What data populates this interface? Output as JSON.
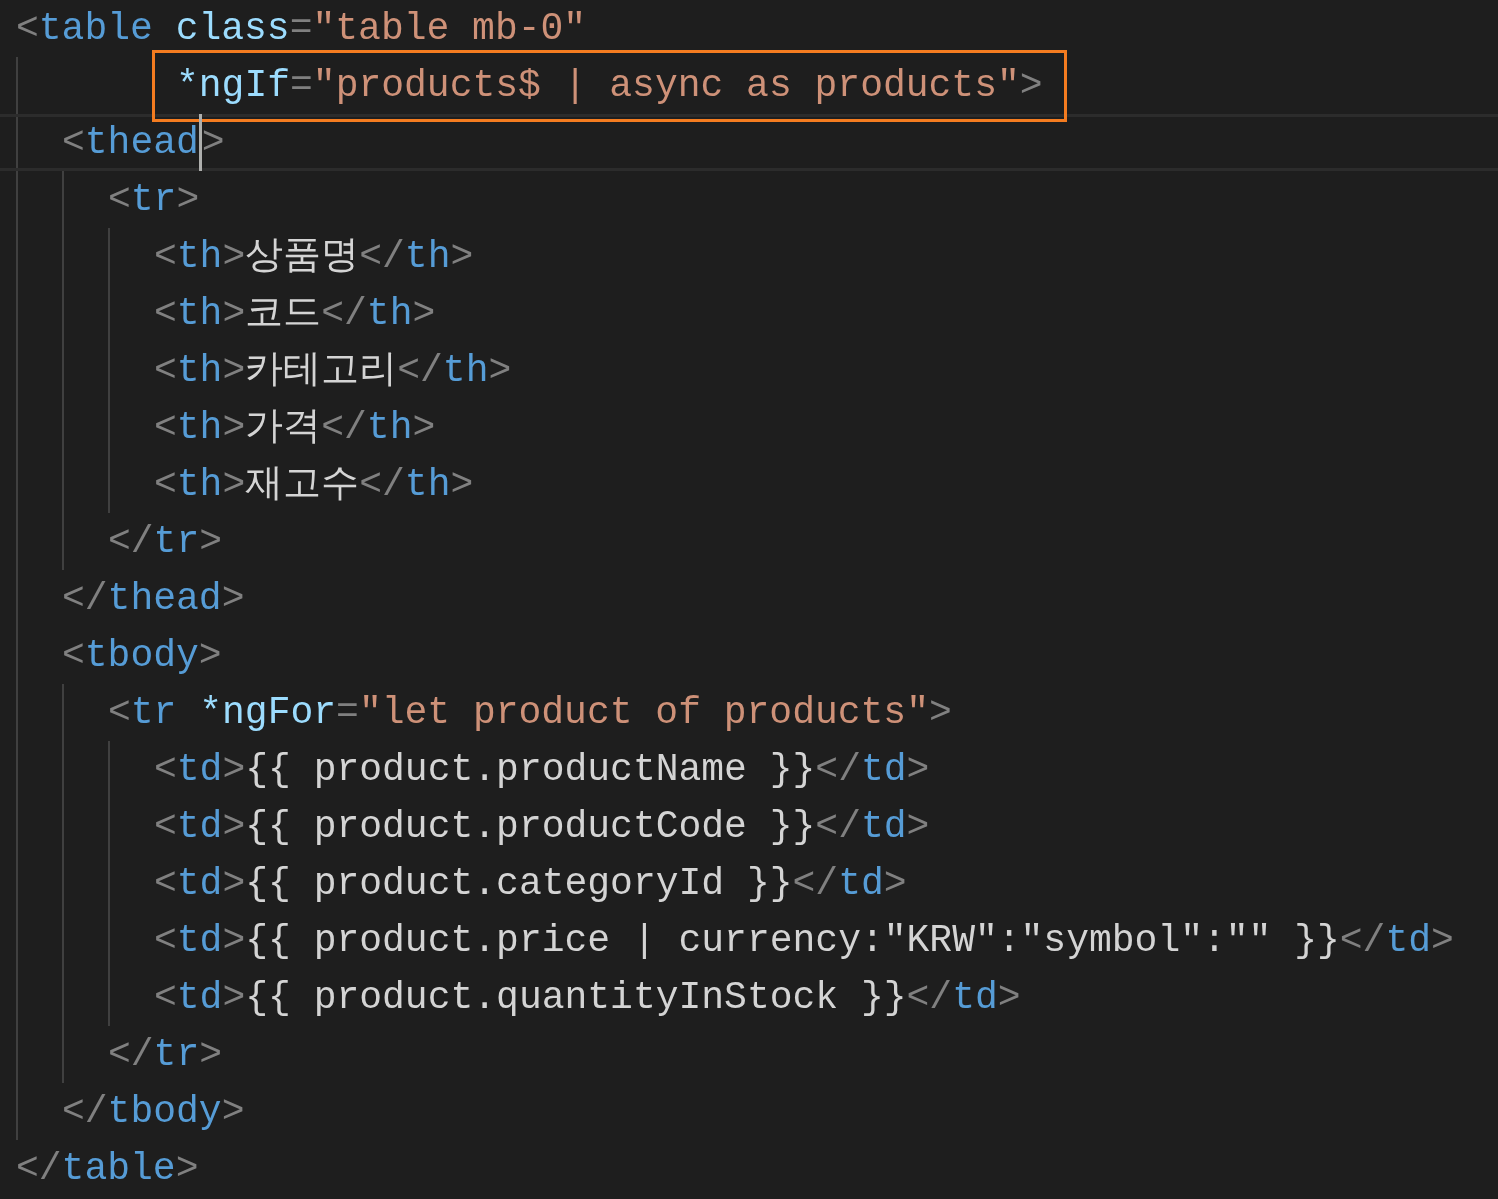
{
  "lines": [
    {
      "tokens": [
        {
          "kind": "punct",
          "text": "<"
        },
        {
          "kind": "tag",
          "text": "table"
        },
        {
          "kind": "attr",
          "text": " class"
        },
        {
          "kind": "punct",
          "text": "="
        },
        {
          "kind": "string",
          "text": "\"table mb-0\""
        }
      ],
      "continuation": {
        "highlighted": true,
        "tokens": [
          {
            "kind": "attr",
            "text": "*ngIf"
          },
          {
            "kind": "punct",
            "text": "="
          },
          {
            "kind": "string",
            "text": "\"products$ | async as products\""
          },
          {
            "kind": "punct",
            "text": ">"
          }
        ]
      },
      "children": [
        {
          "current": true,
          "tokens": [
            {
              "kind": "punct",
              "text": "<"
            },
            {
              "kind": "tag",
              "text": "thead",
              "cursor": true
            },
            {
              "kind": "punct",
              "text": ">"
            }
          ],
          "children": [
            {
              "tokens": [
                {
                  "kind": "punct",
                  "text": "<"
                },
                {
                  "kind": "tag",
                  "text": "tr"
                },
                {
                  "kind": "punct",
                  "text": ">"
                }
              ],
              "children": [
                {
                  "tokens": [
                    {
                      "kind": "punct",
                      "text": "<"
                    },
                    {
                      "kind": "tag",
                      "text": "th"
                    },
                    {
                      "kind": "punct",
                      "text": ">"
                    },
                    {
                      "kind": "text",
                      "text": "상품명"
                    },
                    {
                      "kind": "punct",
                      "text": "</"
                    },
                    {
                      "kind": "tag",
                      "text": "th"
                    },
                    {
                      "kind": "punct",
                      "text": ">"
                    }
                  ]
                },
                {
                  "tokens": [
                    {
                      "kind": "punct",
                      "text": "<"
                    },
                    {
                      "kind": "tag",
                      "text": "th"
                    },
                    {
                      "kind": "punct",
                      "text": ">"
                    },
                    {
                      "kind": "text",
                      "text": "코드"
                    },
                    {
                      "kind": "punct",
                      "text": "</"
                    },
                    {
                      "kind": "tag",
                      "text": "th"
                    },
                    {
                      "kind": "punct",
                      "text": ">"
                    }
                  ]
                },
                {
                  "tokens": [
                    {
                      "kind": "punct",
                      "text": "<"
                    },
                    {
                      "kind": "tag",
                      "text": "th"
                    },
                    {
                      "kind": "punct",
                      "text": ">"
                    },
                    {
                      "kind": "text",
                      "text": "카테고리"
                    },
                    {
                      "kind": "punct",
                      "text": "</"
                    },
                    {
                      "kind": "tag",
                      "text": "th"
                    },
                    {
                      "kind": "punct",
                      "text": ">"
                    }
                  ]
                },
                {
                  "tokens": [
                    {
                      "kind": "punct",
                      "text": "<"
                    },
                    {
                      "kind": "tag",
                      "text": "th"
                    },
                    {
                      "kind": "punct",
                      "text": ">"
                    },
                    {
                      "kind": "text",
                      "text": "가격"
                    },
                    {
                      "kind": "punct",
                      "text": "</"
                    },
                    {
                      "kind": "tag",
                      "text": "th"
                    },
                    {
                      "kind": "punct",
                      "text": ">"
                    }
                  ]
                },
                {
                  "tokens": [
                    {
                      "kind": "punct",
                      "text": "<"
                    },
                    {
                      "kind": "tag",
                      "text": "th"
                    },
                    {
                      "kind": "punct",
                      "text": ">"
                    },
                    {
                      "kind": "text",
                      "text": "재고수"
                    },
                    {
                      "kind": "punct",
                      "text": "</"
                    },
                    {
                      "kind": "tag",
                      "text": "th"
                    },
                    {
                      "kind": "punct",
                      "text": ">"
                    }
                  ]
                }
              ]
            },
            {
              "tokens": [
                {
                  "kind": "punct",
                  "text": "</"
                },
                {
                  "kind": "tag",
                  "text": "tr"
                },
                {
                  "kind": "punct",
                  "text": ">"
                }
              ]
            }
          ]
        },
        {
          "tokens": [
            {
              "kind": "punct",
              "text": "</"
            },
            {
              "kind": "tag",
              "text": "thead"
            },
            {
              "kind": "punct",
              "text": ">"
            }
          ]
        },
        {
          "tokens": [
            {
              "kind": "punct",
              "text": "<"
            },
            {
              "kind": "tag",
              "text": "tbody"
            },
            {
              "kind": "punct",
              "text": ">"
            }
          ],
          "children": [
            {
              "tokens": [
                {
                  "kind": "punct",
                  "text": "<"
                },
                {
                  "kind": "tag",
                  "text": "tr"
                },
                {
                  "kind": "attr",
                  "text": " *ngFor"
                },
                {
                  "kind": "punct",
                  "text": "="
                },
                {
                  "kind": "string",
                  "text": "\"let product of products\""
                },
                {
                  "kind": "punct",
                  "text": ">"
                }
              ],
              "children": [
                {
                  "tokens": [
                    {
                      "kind": "punct",
                      "text": "<"
                    },
                    {
                      "kind": "tag",
                      "text": "td"
                    },
                    {
                      "kind": "punct",
                      "text": ">"
                    },
                    {
                      "kind": "text",
                      "text": "{{ product.productName }}"
                    },
                    {
                      "kind": "punct",
                      "text": "</"
                    },
                    {
                      "kind": "tag",
                      "text": "td"
                    },
                    {
                      "kind": "punct",
                      "text": ">"
                    }
                  ]
                },
                {
                  "tokens": [
                    {
                      "kind": "punct",
                      "text": "<"
                    },
                    {
                      "kind": "tag",
                      "text": "td"
                    },
                    {
                      "kind": "punct",
                      "text": ">"
                    },
                    {
                      "kind": "text",
                      "text": "{{ product.productCode }}"
                    },
                    {
                      "kind": "punct",
                      "text": "</"
                    },
                    {
                      "kind": "tag",
                      "text": "td"
                    },
                    {
                      "kind": "punct",
                      "text": ">"
                    }
                  ]
                },
                {
                  "tokens": [
                    {
                      "kind": "punct",
                      "text": "<"
                    },
                    {
                      "kind": "tag",
                      "text": "td"
                    },
                    {
                      "kind": "punct",
                      "text": ">"
                    },
                    {
                      "kind": "text",
                      "text": "{{ product.categoryId }}"
                    },
                    {
                      "kind": "punct",
                      "text": "</"
                    },
                    {
                      "kind": "tag",
                      "text": "td"
                    },
                    {
                      "kind": "punct",
                      "text": ">"
                    }
                  ]
                },
                {
                  "tokens": [
                    {
                      "kind": "punct",
                      "text": "<"
                    },
                    {
                      "kind": "tag",
                      "text": "td"
                    },
                    {
                      "kind": "punct",
                      "text": ">"
                    },
                    {
                      "kind": "text",
                      "text": "{{ product.price | currency:\"KRW\":\"symbol\":\"\" }}"
                    },
                    {
                      "kind": "punct",
                      "text": "</"
                    },
                    {
                      "kind": "tag",
                      "text": "td"
                    },
                    {
                      "kind": "punct",
                      "text": ">"
                    }
                  ]
                },
                {
                  "tokens": [
                    {
                      "kind": "punct",
                      "text": "<"
                    },
                    {
                      "kind": "tag",
                      "text": "td"
                    },
                    {
                      "kind": "punct",
                      "text": ">"
                    },
                    {
                      "kind": "text",
                      "text": "{{ product.quantityInStock }}"
                    },
                    {
                      "kind": "punct",
                      "text": "</"
                    },
                    {
                      "kind": "tag",
                      "text": "td"
                    },
                    {
                      "kind": "punct",
                      "text": ">"
                    }
                  ]
                }
              ]
            },
            {
              "tokens": [
                {
                  "kind": "punct",
                  "text": "</"
                },
                {
                  "kind": "tag",
                  "text": "tr"
                },
                {
                  "kind": "punct",
                  "text": ">"
                }
              ]
            }
          ]
        },
        {
          "tokens": [
            {
              "kind": "punct",
              "text": "</"
            },
            {
              "kind": "tag",
              "text": "tbody"
            },
            {
              "kind": "punct",
              "text": ">"
            }
          ]
        }
      ]
    },
    {
      "tokens": [
        {
          "kind": "punct",
          "text": "</"
        },
        {
          "kind": "tag",
          "text": "table"
        },
        {
          "kind": "punct",
          "text": ">"
        }
      ]
    }
  ]
}
